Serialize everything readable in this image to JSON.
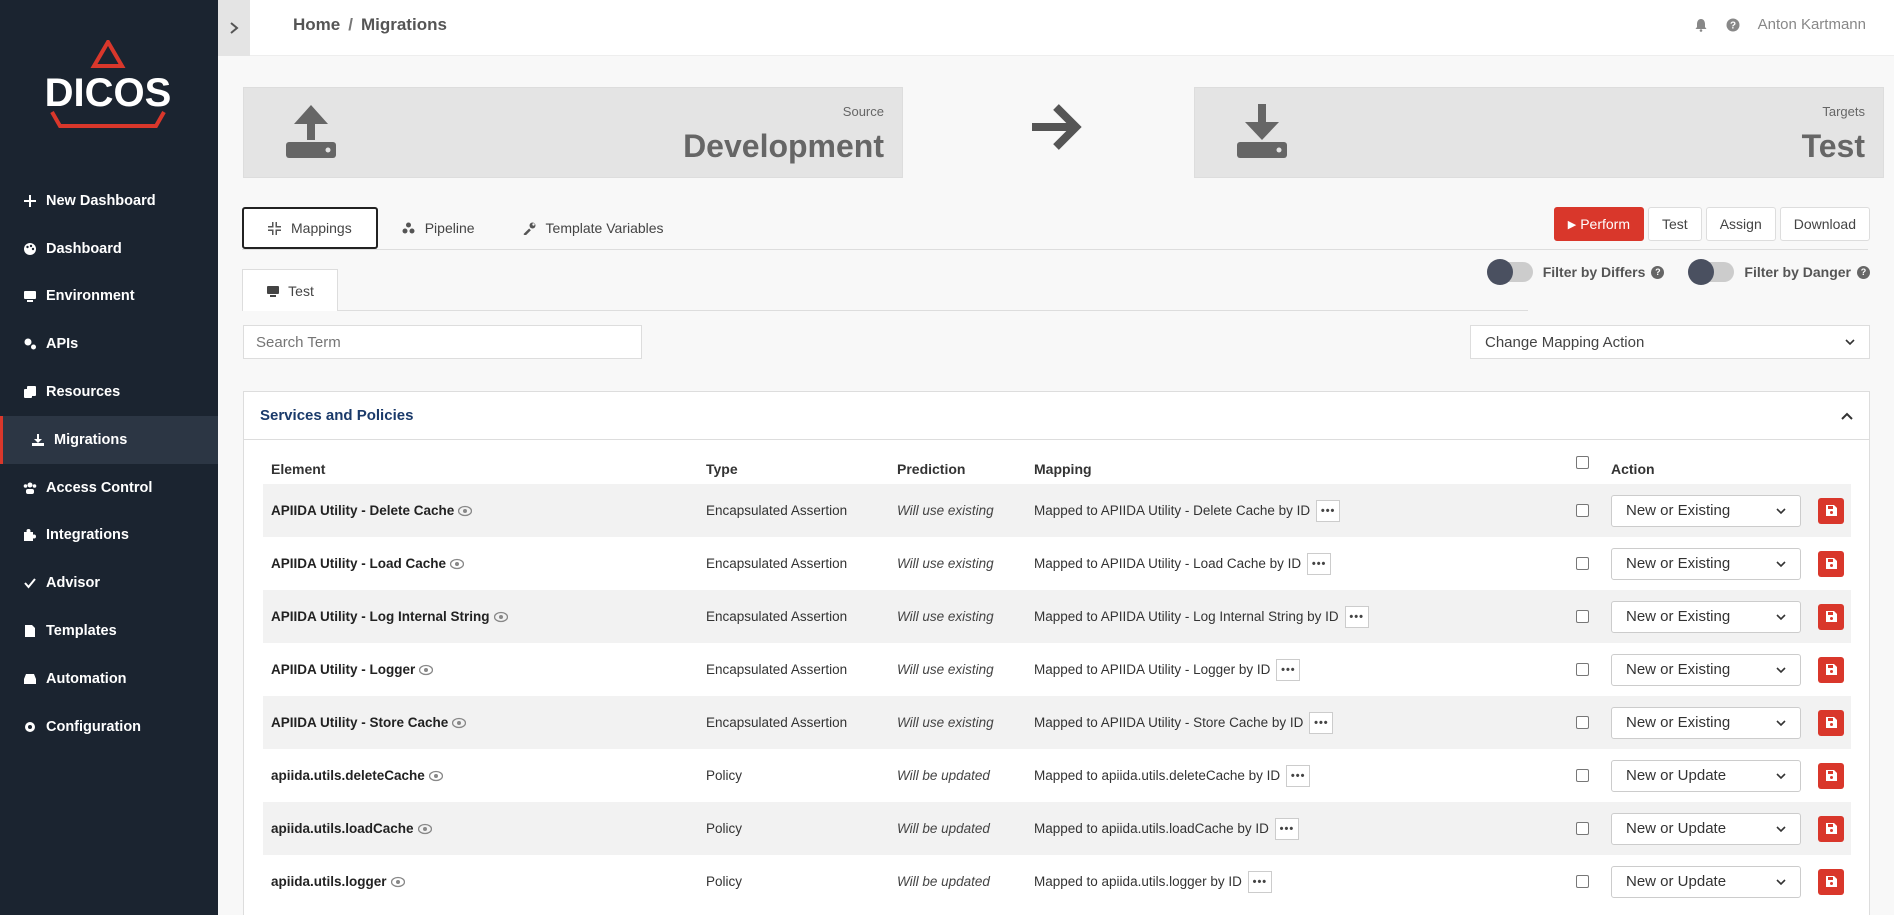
{
  "sidebar": {
    "logo_text": "DICOS",
    "items": [
      {
        "label": "New Dashboard",
        "icon": "plus-icon"
      },
      {
        "label": "Dashboard",
        "icon": "palette-icon"
      },
      {
        "label": "Environment",
        "icon": "monitor-icon"
      },
      {
        "label": "APIs",
        "icon": "cogs-icon"
      },
      {
        "label": "Resources",
        "icon": "copy-icon"
      },
      {
        "label": "Migrations",
        "icon": "download-icon",
        "active": true
      },
      {
        "label": "Access Control",
        "icon": "users-icon"
      },
      {
        "label": "Integrations",
        "icon": "puzzle-icon"
      },
      {
        "label": "Advisor",
        "icon": "check-icon"
      },
      {
        "label": "Templates",
        "icon": "file-icon"
      },
      {
        "label": "Automation",
        "icon": "inbox-icon"
      },
      {
        "label": "Configuration",
        "icon": "gear-icon"
      }
    ]
  },
  "topbar": {
    "breadcrumb": {
      "home": "Home",
      "separator": "/",
      "current": "Migrations"
    },
    "user_name": "Anton Kartmann"
  },
  "source": {
    "caption": "Source",
    "name": "Development"
  },
  "targets": {
    "caption": "Targets",
    "name": "Test"
  },
  "tabs": [
    {
      "label": "Mappings",
      "icon": "compress-icon",
      "active": true
    },
    {
      "label": "Pipeline",
      "icon": "pipeline-icon"
    },
    {
      "label": "Template Variables",
      "icon": "wrench-icon"
    }
  ],
  "actions": {
    "perform": "Perform",
    "test": "Test",
    "assign": "Assign",
    "download": "Download"
  },
  "filters": {
    "differs": "Filter by Differs",
    "danger": "Filter by Danger"
  },
  "subtab": {
    "label": "Test"
  },
  "search": {
    "placeholder": "Search Term"
  },
  "mapping_action": {
    "label": "Change Mapping Action"
  },
  "section": {
    "title": "Services and Policies"
  },
  "table": {
    "headers": {
      "element": "Element",
      "type": "Type",
      "prediction": "Prediction",
      "mapping": "Mapping",
      "action": "Action"
    },
    "rows": [
      {
        "element": "APIIDA Utility - Delete Cache",
        "type": "Encapsulated Assertion",
        "prediction": "Will use existing",
        "mapping": "Mapped to APIIDA Utility - Delete Cache by ID",
        "action": "New or Existing"
      },
      {
        "element": "APIIDA Utility - Load Cache",
        "type": "Encapsulated Assertion",
        "prediction": "Will use existing",
        "mapping": "Mapped to APIIDA Utility - Load Cache by ID",
        "action": "New or Existing"
      },
      {
        "element": "APIIDA Utility - Log Internal String",
        "type": "Encapsulated Assertion",
        "prediction": "Will use existing",
        "mapping": "Mapped to APIIDA Utility - Log Internal String by ID",
        "action": "New or Existing"
      },
      {
        "element": "APIIDA Utility - Logger",
        "type": "Encapsulated Assertion",
        "prediction": "Will use existing",
        "mapping": "Mapped to APIIDA Utility - Logger by ID",
        "action": "New or Existing"
      },
      {
        "element": "APIIDA Utility - Store Cache",
        "type": "Encapsulated Assertion",
        "prediction": "Will use existing",
        "mapping": "Mapped to APIIDA Utility - Store Cache by ID",
        "action": "New or Existing"
      },
      {
        "element": "apiida.utils.deleteCache",
        "type": "Policy",
        "prediction": "Will be updated",
        "mapping": "Mapped to apiida.utils.deleteCache by ID",
        "action": "New or Update"
      },
      {
        "element": "apiida.utils.loadCache",
        "type": "Policy",
        "prediction": "Will be updated",
        "mapping": "Mapped to apiida.utils.loadCache by ID",
        "action": "New or Update"
      },
      {
        "element": "apiida.utils.logger",
        "type": "Policy",
        "prediction": "Will be updated",
        "mapping": "Mapped to apiida.utils.logger by ID",
        "action": "New or Update"
      }
    ]
  },
  "colors": {
    "sidebar": "#1b2430",
    "accent": "#d9372b",
    "link": "#1a3a6a"
  }
}
